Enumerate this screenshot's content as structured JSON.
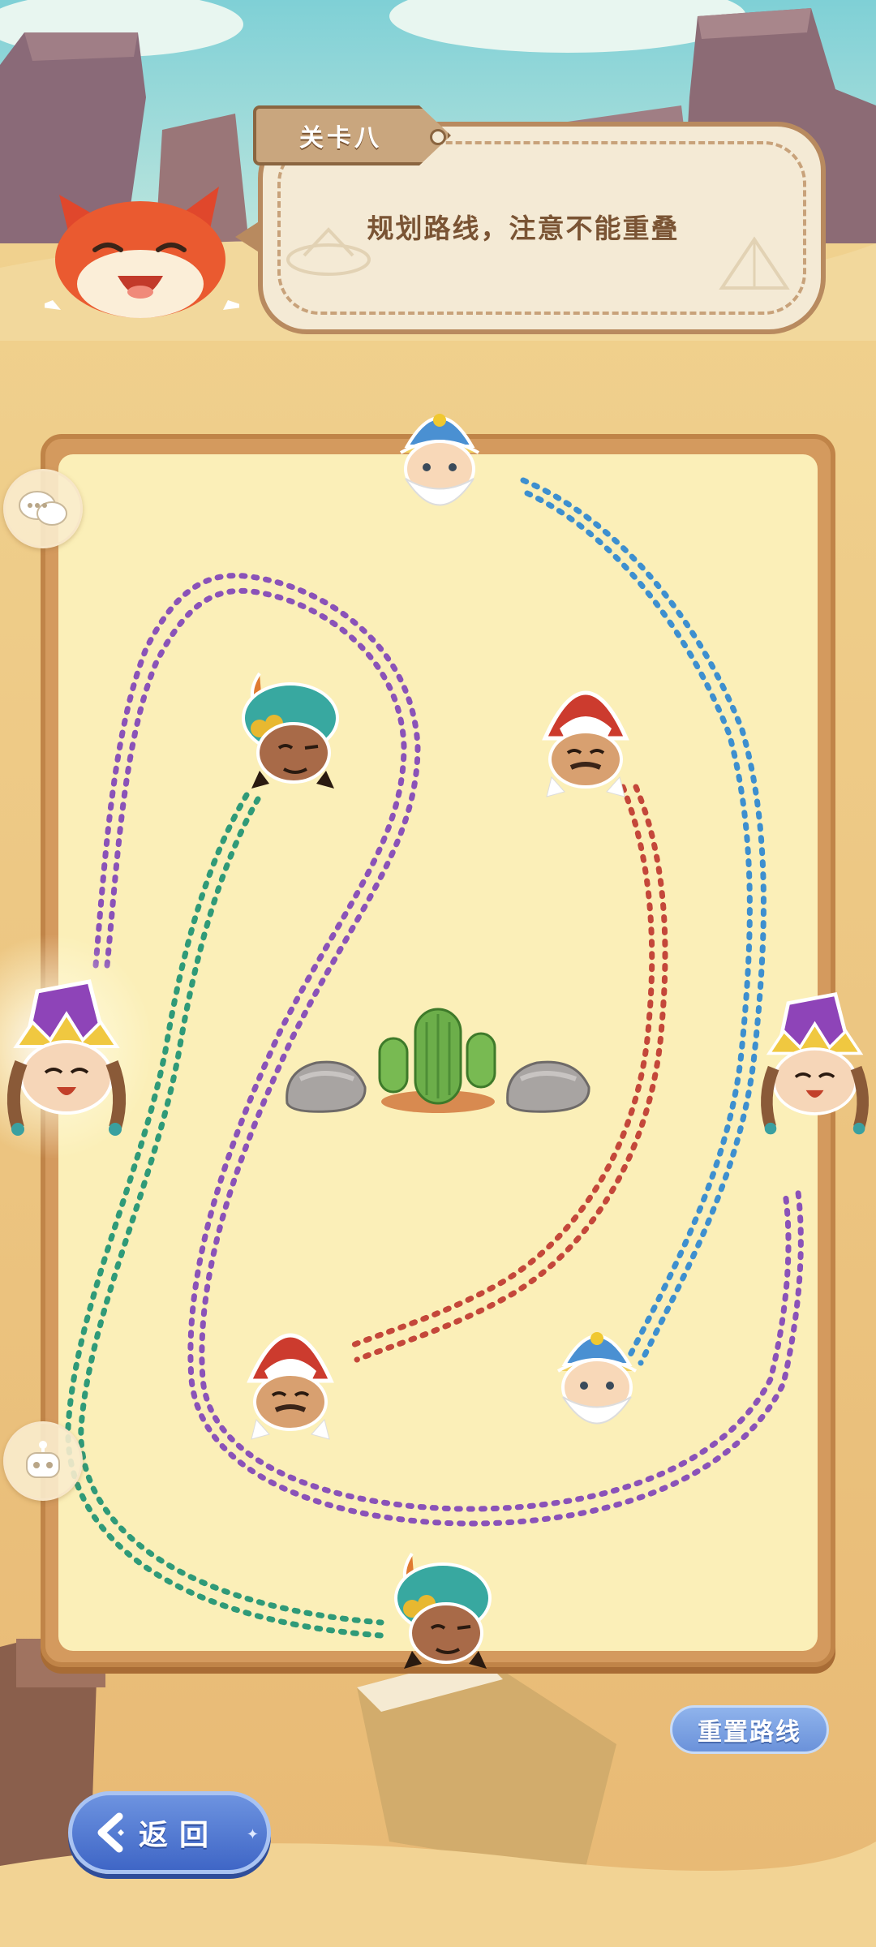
{
  "level": {
    "label": "关卡八"
  },
  "instruction": "规划路线，注意不能重叠",
  "buttons": {
    "reset": "重置路线",
    "back": "返回"
  },
  "colors": {
    "purple_path": "#8a52b8",
    "teal_path": "#2f9a78",
    "red_path": "#c4473a",
    "blue_path": "#3d8fcf",
    "board": "#fbefb8",
    "frame": "#d49a5e"
  },
  "characters": [
    {
      "name": "old-wizard-blue-hat",
      "pair": "blue"
    },
    {
      "name": "turban-man-teal",
      "pair": "teal"
    },
    {
      "name": "gnome-red-hat",
      "pair": "red"
    },
    {
      "name": "princess-purple-crown",
      "pair": "purple"
    }
  ],
  "obstacle": {
    "center": "cactus",
    "sides": [
      "rock",
      "rock"
    ]
  },
  "icons": {
    "chat": "chat-bubbles-icon",
    "bot": "robot-icon",
    "back": "back-arrow-icon"
  }
}
